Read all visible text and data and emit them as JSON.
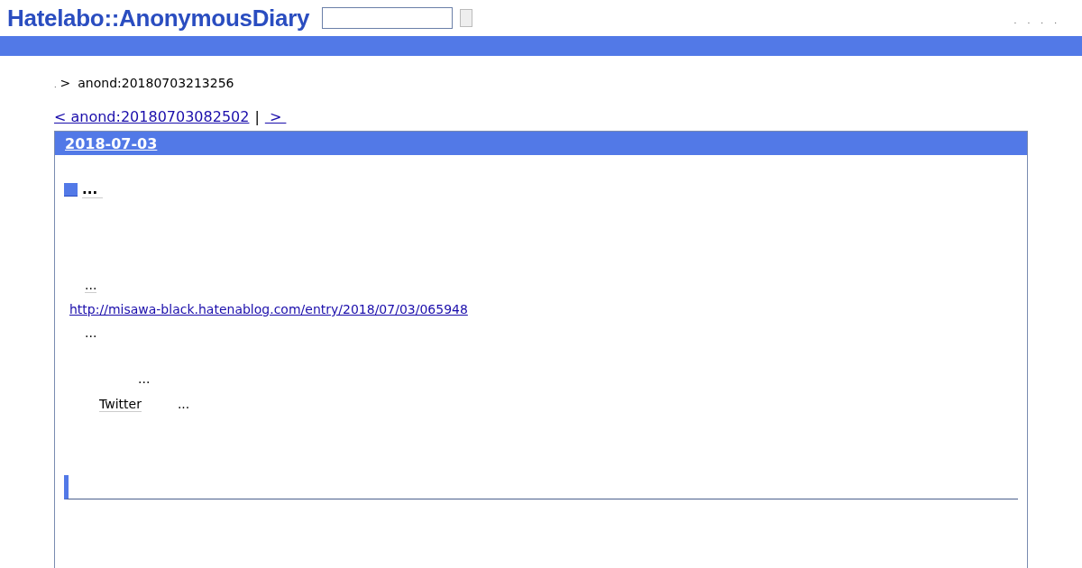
{
  "header": {
    "logo": "Hatelabo::AnonymousDiary",
    "nav": [
      ".",
      ".",
      ".",
      "."
    ]
  },
  "breadcrumb": {
    "home": ".",
    "separator": ">",
    "current": "anond:20180703213256"
  },
  "pager": {
    "prev": "< anond:20180703082502",
    "divider": "|",
    "next": " > "
  },
  "day": {
    "date": "2018-07-03",
    "section_title": "...",
    "body": [
      {
        "parts": [
          {
            "kind": "keyword",
            "text": "..."
          }
        ]
      },
      {
        "parts": [
          {
            "kind": "url",
            "text": "http://misawa-black.hatenablog.com/entry/2018/07/03/065948"
          }
        ]
      },
      {
        "parts": [
          {
            "kind": "text",
            "text": "..."
          }
        ]
      },
      {
        "parts": [
          {
            "kind": "text",
            "text": "..."
          }
        ]
      },
      {
        "parts": [
          {
            "kind": "keyword",
            "text": "Twitter"
          },
          {
            "kind": "text",
            "text": "..."
          }
        ]
      }
    ]
  }
}
